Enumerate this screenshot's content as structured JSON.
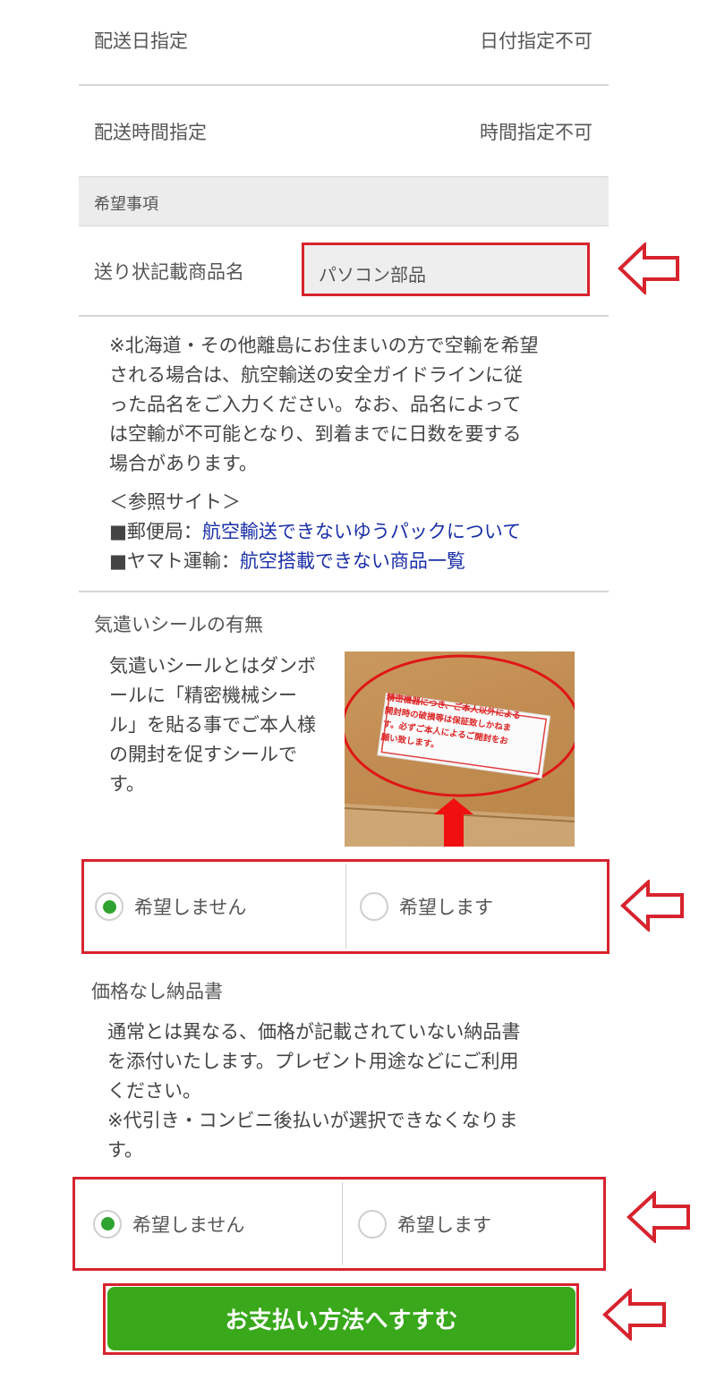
{
  "rows": {
    "delivery_date": {
      "label": "配送日指定",
      "value": "日付指定不可"
    },
    "delivery_time": {
      "label": "配送時間指定",
      "value": "時間指定不可"
    }
  },
  "section_title": "希望事項",
  "product_name": {
    "label": "送り状記載商品名",
    "value": "パソコン部品"
  },
  "air_note": {
    "line1": "※北海道・その他離島にお住まいの方で空輸を希望",
    "line2": "される場合は、航空輸送の安全ガイドラインに従",
    "line3": "った品名をご入力ください。なお、品名によって",
    "line4": "は空輸が不可能となり、到着までに日数を要する",
    "line5": "場合があります。",
    "ref_title": "＜参照サイト＞",
    "ref1_prefix": "■郵便局：",
    "ref1_link": "航空輸送できないゆうパックについて",
    "ref2_prefix": "■ヤマト運輸：",
    "ref2_link": "航空搭載できない商品一覧"
  },
  "seal": {
    "title": "気遣いシールの有無",
    "desc1": "気遣いシールとはダンボ",
    "desc2": "ールに「精密機械シー",
    "desc3": "ル」を貼る事でご本人様",
    "desc4": "の開封を促すシールで",
    "desc5": "す。",
    "sticker_line1": "精密機器につき、ご本人以外による",
    "sticker_line2": "開封時の破損等は保証致しかねま",
    "sticker_line3": "す。必ずご本人によるご開封をお",
    "sticker_line4": "願い致します。",
    "option_no": "希望しません",
    "option_yes": "希望します",
    "selected": "no"
  },
  "invoice": {
    "title": "価格なし納品書",
    "desc1": "通常とは異なる、価格が記載されていない納品書",
    "desc2": "を添付いたします。プレゼント用途などにご利用",
    "desc3": "ください。",
    "desc4": "※代引き・コンビニ後払いが選択できなくなりま",
    "desc5": "す。",
    "option_no": "希望しません",
    "option_yes": "希望します",
    "selected": "no"
  },
  "submit_label": "お支払い方法へすすむ",
  "colors": {
    "accent_red": "#d7232e",
    "button_green": "#39a81b",
    "link_blue": "#1a2fa8",
    "radio_green": "#2fa32f"
  }
}
